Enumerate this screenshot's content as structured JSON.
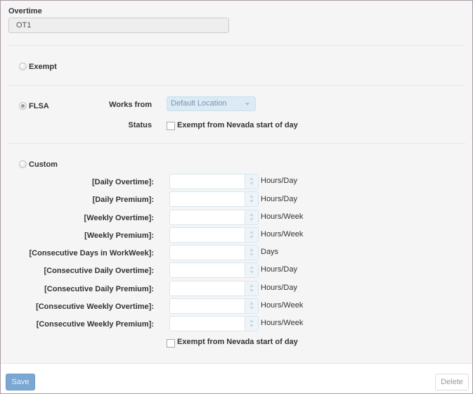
{
  "overtime": {
    "label": "Overtime",
    "value": "OT1"
  },
  "options": {
    "exempt": {
      "label": "Exempt",
      "checked": false
    },
    "flsa": {
      "label": "FLSA",
      "checked": true,
      "works_from_label": "Works from",
      "works_from_value": "Default Location",
      "status_label": "Status",
      "status_checkbox_label": "Exempt from Nevada start of day"
    },
    "custom": {
      "label": "Custom",
      "checked": false,
      "fields": [
        {
          "label": "[Daily Overtime]:",
          "value": "",
          "unit": "Hours/Day"
        },
        {
          "label": "[Daily Premium]:",
          "value": "",
          "unit": "Hours/Day"
        },
        {
          "label": "[Weekly Overtime]:",
          "value": "",
          "unit": "Hours/Week"
        },
        {
          "label": "[Weekly Premium]:",
          "value": "",
          "unit": "Hours/Week"
        },
        {
          "label": "[Consecutive Days in WorkWeek]:",
          "value": "",
          "unit": "Days"
        },
        {
          "label": "[Consecutive Daily Overtime]:",
          "value": "",
          "unit": "Hours/Day"
        },
        {
          "label": "[Consecutive Daily Premium]:",
          "value": "",
          "unit": "Hours/Day"
        },
        {
          "label": "[Consecutive Weekly Overtime]:",
          "value": "",
          "unit": "Hours/Week"
        },
        {
          "label": "[Consecutive Weekly Premium]:",
          "value": "",
          "unit": "Hours/Week"
        }
      ],
      "checkbox_label": "Exempt from Nevada start of day"
    }
  },
  "footer": {
    "save_label": "Save",
    "delete_label": "Delete"
  }
}
